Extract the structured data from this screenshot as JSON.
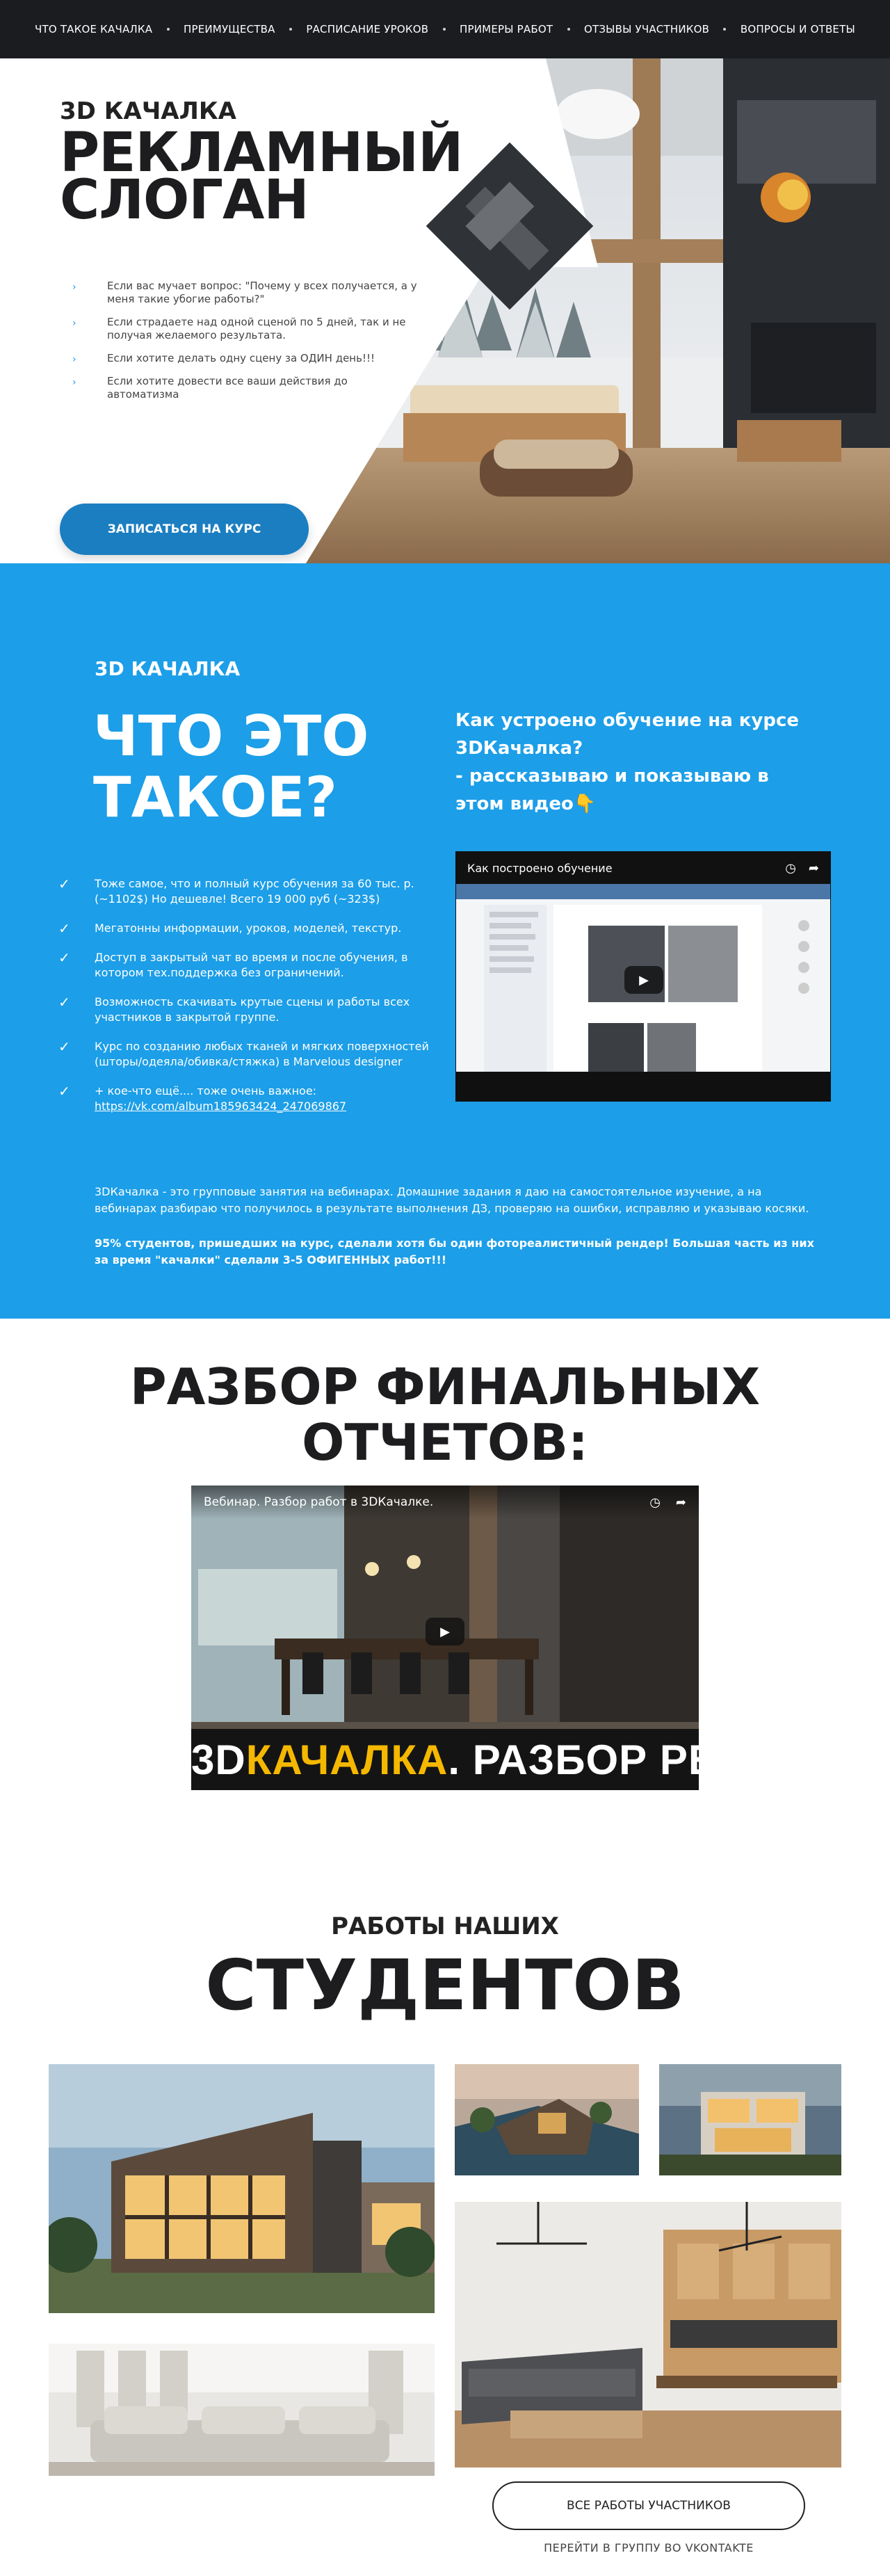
{
  "nav": {
    "items": [
      "ЧТО ТАКОЕ КАЧАЛКА",
      "ПРЕИМУЩЕСТВА",
      "РАСПИСАНИЕ УРОКОВ",
      "ПРИМЕРЫ РАБОТ",
      "ОТЗЫВЫ УЧАСТНИКОВ",
      "ВОПРОСЫ И ОТВЕТЫ"
    ]
  },
  "hero": {
    "kicker": "3D КАЧАЛКА",
    "title_line1": "РЕКЛАМНЫЙ",
    "title_line2": "СЛОГАН",
    "bullets": [
      "Если вас мучает вопрос: \"Почему у всех получается, а у меня такие убогие работы?\"",
      "Если страдаете над одной сценой по 5 дней, так и не получая желаемого результата.",
      "Если хотите делать одну сцену за ОДИН день!!!",
      "Если хотите довести все ваши действия до автоматизма"
    ],
    "cta": "ЗАПИСАТЬСЯ НА КУРС"
  },
  "about": {
    "kicker": "3D КАЧАЛКА",
    "title_line1": "ЧТО ЭТО",
    "title_line2": "ТАКОЕ?",
    "video_intro": "Как устроено обучение на курсе 3DКачалка?\n- рассказываю и показываю в этом видео👇",
    "video_title": "Как построено обучение",
    "checks": [
      "Тоже самое, что и полный курс обучения за 60 тыс. р. (~1102$) Но дешевле! Всего 19 000 руб (~323$)",
      "Мегатонны информации, уроков, моделей, текстур.",
      "Доступ в закрытый чат во время и после обучения, в котором тех.поддержка без ограничений.",
      "Возможность скачивать крутые сцены и работы всех участников в закрытой группе.",
      "Курс по созданию любых тканей и мягких поверхностей (шторы/одеяла/обивка/стяжка) в Marvelous designer",
      "+ кое-что ещё.... тоже очень важное:"
    ],
    "link": "https://vk.com/album185963424_247069867",
    "para1": "3DКачалка - это групповые занятия на вебинарах. Домашние задания я даю на самостоятельное изучение, а на вебинарах разбираю что получилось в результате выполнения ДЗ, проверяю на ошибки, исправляю и указываю косяки.",
    "para2": "95% студентов, пришедших на курс, сделали хотя бы один фотореалистичный рендер! Большая часть из них за время \"качалки\" сделали 3-5 ОФИГЕННЫХ работ!!!"
  },
  "review": {
    "title_line1": "РАЗБОР ФИНАЛЬНЫХ",
    "title_line2": "ОТЧЕТОВ:",
    "video_title": "Вебинар. Разбор работ в 3DКачалке.",
    "banner_a": "3D",
    "banner_b": "КАЧАЛКА",
    "banner_c": ". РАЗБОР РЕНДЕРОВ"
  },
  "works": {
    "kicker": "РАБОТЫ НАШИХ",
    "title": "СТУДЕНТОВ",
    "btn_all": "ВСЕ РАБОТЫ УЧАСТНИКОВ",
    "link_vk": "ПЕРЕЙТИ В ГРУППУ ВО VKONTAKTE"
  },
  "colors": {
    "accent": "#1c9ee8",
    "button": "#1b7ec1",
    "nav": "#1b1c20",
    "banner_yellow": "#f5b800"
  }
}
